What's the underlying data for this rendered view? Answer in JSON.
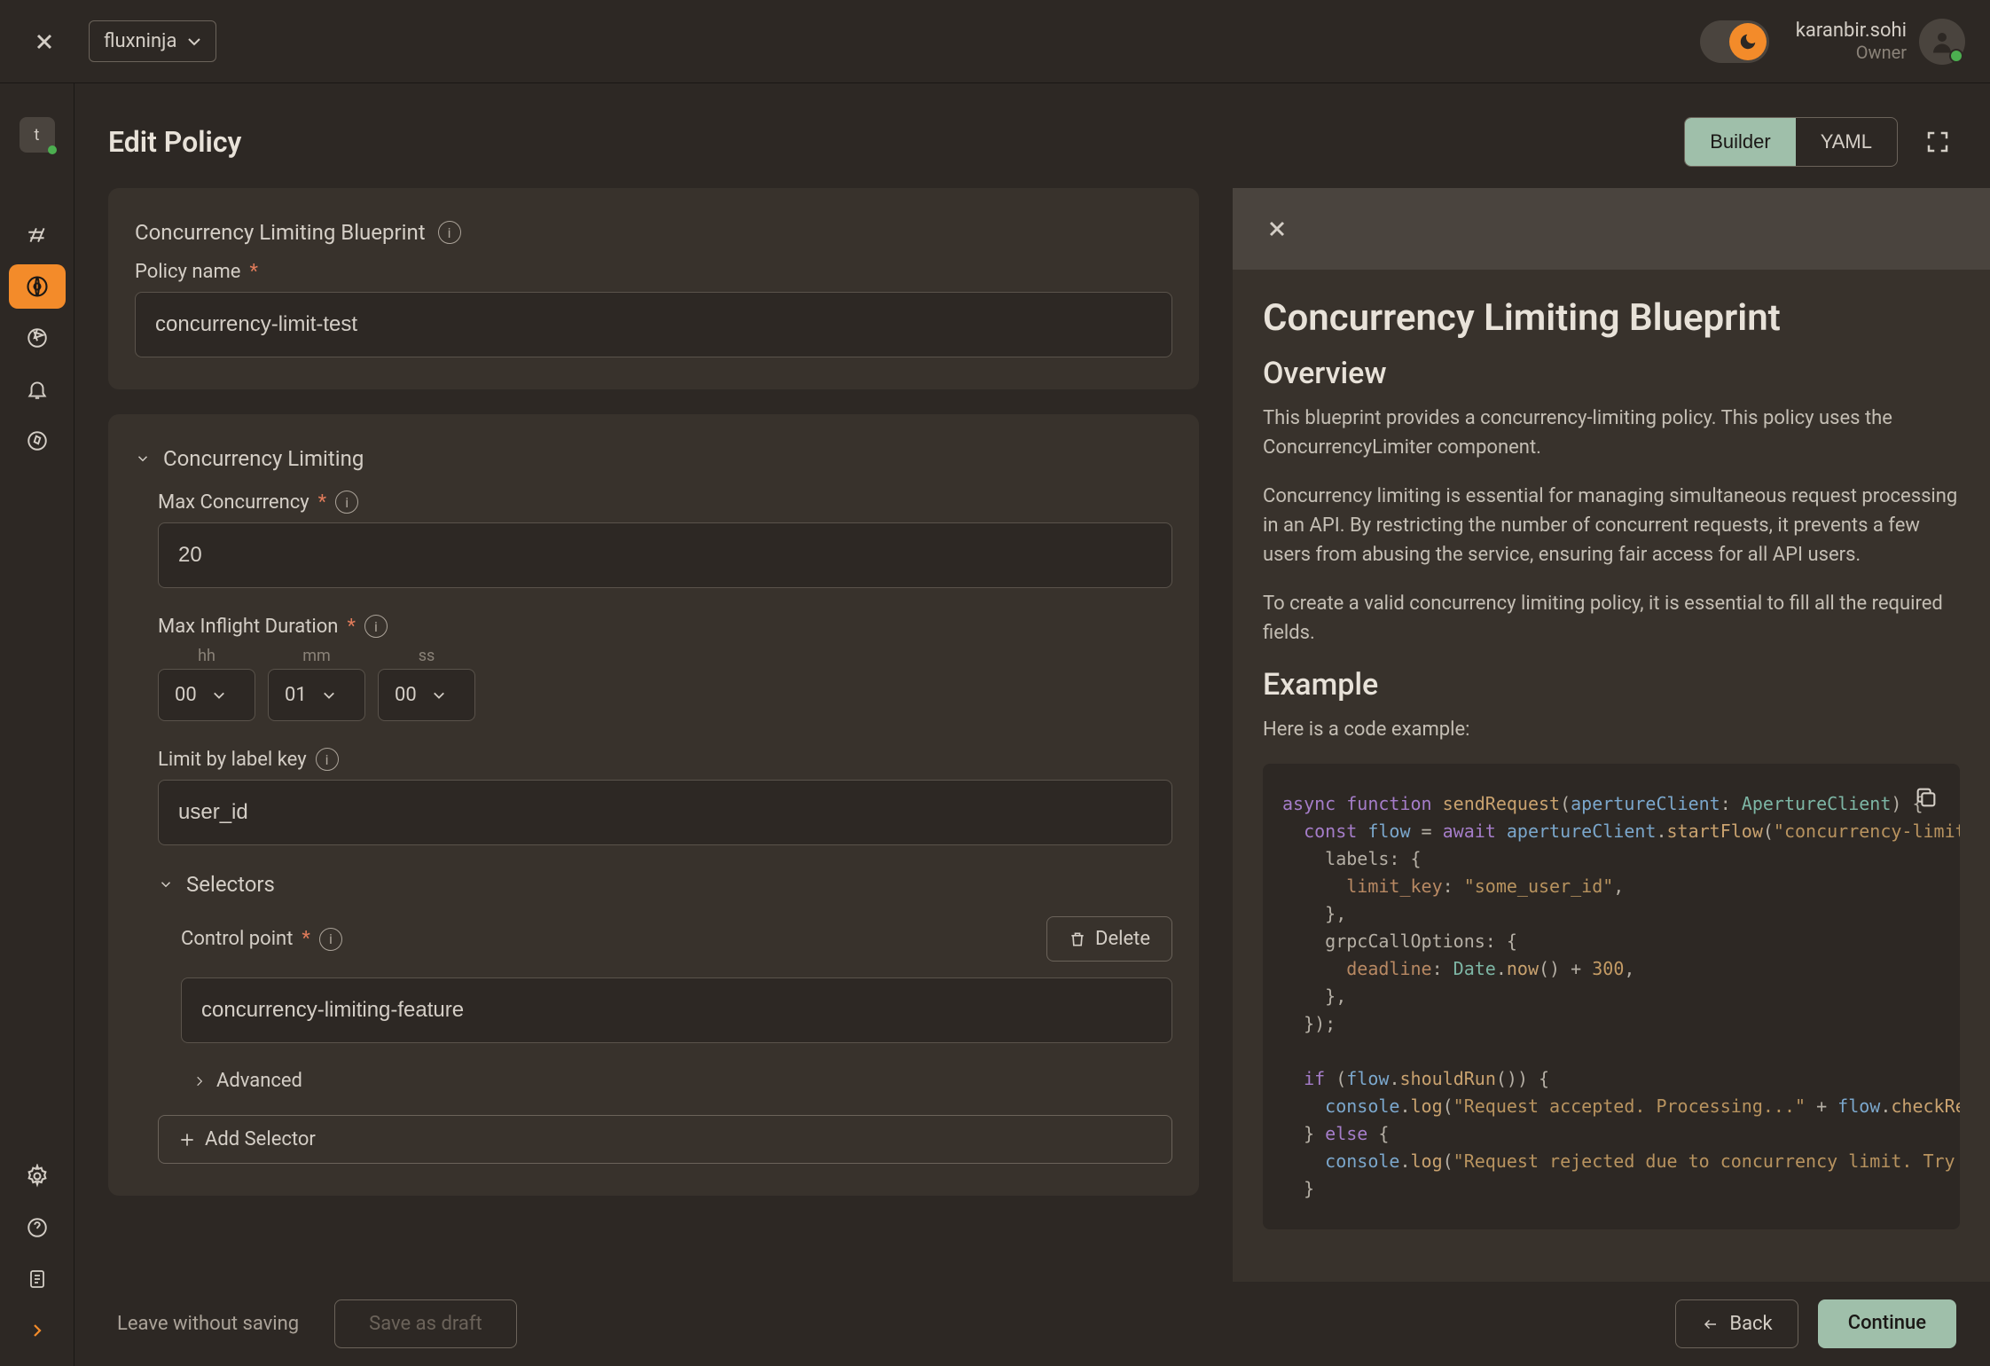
{
  "top": {
    "project": "fluxninja",
    "user_name": "karanbir.sohi",
    "user_role": "Owner"
  },
  "rail": {
    "project_badge": "t"
  },
  "header": {
    "title": "Edit Policy",
    "tab_builder": "Builder",
    "tab_yaml": "YAML"
  },
  "form": {
    "blueprint_label": "Concurrency Limiting Blueprint",
    "policy_name_label": "Policy name",
    "policy_name_value": "concurrency-limit-test",
    "section_concurrency": "Concurrency Limiting",
    "max_concurrency_label": "Max Concurrency",
    "max_concurrency_value": "20",
    "max_inflight_label": "Max Inflight Duration",
    "duration": {
      "hh_label": "hh",
      "hh_value": "00",
      "mm_label": "mm",
      "mm_value": "01",
      "ss_label": "ss",
      "ss_value": "00"
    },
    "limit_by_label": "Limit by label key",
    "limit_by_value": "user_id",
    "selectors_label": "Selectors",
    "delete_label": "Delete",
    "control_point_label": "Control point",
    "control_point_value": "concurrency-limiting-feature",
    "advanced_label": "Advanced",
    "add_selector_label": "Add Selector"
  },
  "footer": {
    "leave": "Leave without saving",
    "save_draft": "Save as draft",
    "back": "Back",
    "continue": "Continue"
  },
  "doc": {
    "title": "Concurrency Limiting Blueprint",
    "overview_h": "Overview",
    "p1": "This blueprint provides a concurrency-limiting policy. This policy uses the ConcurrencyLimiter component.",
    "p2": "Concurrency limiting is essential for managing simultaneous request processing in an API. By restricting the number of concurrent requests, it prevents a few users from abusing the service, ensuring fair access for all API users.",
    "p3": "To create a valid concurrency limiting policy, it is essential to fill all the required fields.",
    "example_h": "Example",
    "example_intro": "Here is a code example:"
  },
  "code": {
    "l1_async": "async ",
    "l1_function": "function ",
    "l1_name": "sendRequest",
    "l1_p1": "(",
    "l1_arg": "apertureClient",
    "l1_colon": ": ",
    "l1_type": "ApertureClient",
    "l1_p2": ") {",
    "l2_const": "  const ",
    "l2_var": "flow",
    "l2_eq": " = ",
    "l2_await": "await ",
    "l2_obj": "apertureClient",
    "l2_dot": ".",
    "l2_fn": "startFlow",
    "l2_p1": "(",
    "l2_str": "\"concurrency-limiting-featu",
    "l3": "    labels: {",
    "l4_key": "      limit_key",
    "l4_c": ": ",
    "l4_val": "\"some_user_id\"",
    "l4_comma": ",",
    "l5": "    },",
    "l6": "    grpcCallOptions: {",
    "l7_key": "      deadline",
    "l7_c": ": ",
    "l7_date": "Date",
    "l7_dot": ".",
    "l7_now": "now",
    "l7_p": "() + ",
    "l7_num": "300",
    "l7_comma": ",",
    "l8": "    },",
    "l9": "  });",
    "l10": "",
    "l11_if": "  if ",
    "l11_p1": "(",
    "l11_flow": "flow",
    "l11_dot": ".",
    "l11_fn": "shouldRun",
    "l11_p2": "()) {",
    "l12_con": "    console",
    "l12_dot": ".",
    "l12_log": "log",
    "l12_p1": "(",
    "l12_str": "\"Request accepted. Processing...\"",
    "l12_plus": " + ",
    "l12_flow": "flow",
    "l12_dot2": ".",
    "l12_fn": "checkResponse",
    "l12_p2": "())",
    "l13_close": "  } ",
    "l13_else": "else",
    "l13_open": " {",
    "l14_con": "    console",
    "l14_dot": ".",
    "l14_log": "log",
    "l14_p1": "(",
    "l14_str": "\"Request rejected due to concurrency limit. Try again lat",
    "l15": "  }"
  }
}
